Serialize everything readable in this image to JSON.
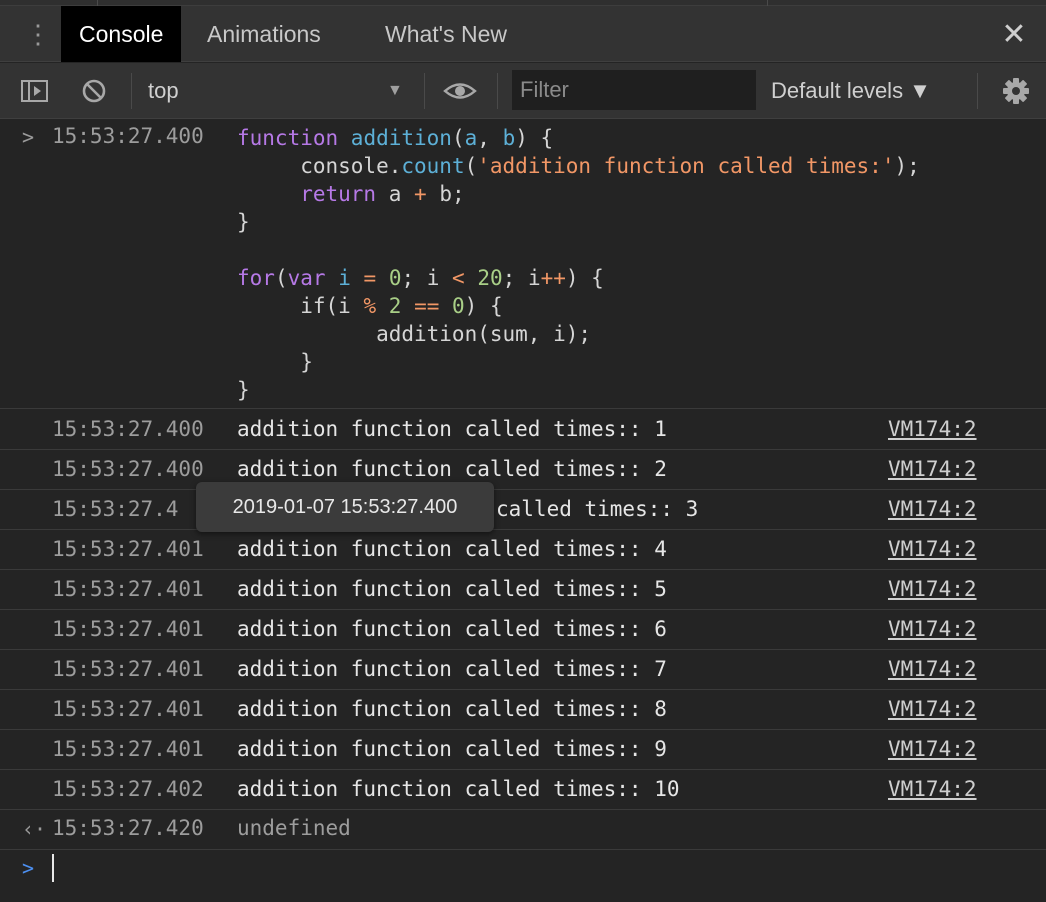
{
  "tabs": {
    "kebab": "⋮",
    "items": [
      {
        "label": "Console"
      },
      {
        "label": "Animations"
      },
      {
        "label": "What's New"
      }
    ],
    "close": "✕"
  },
  "toolbar": {
    "context": "top",
    "context_arrow": "▼",
    "filter_placeholder": "Filter",
    "levels": "Default levels ▼"
  },
  "input_entry": {
    "prompt": ">",
    "timestamp": "15:53:27.400"
  },
  "logs": [
    {
      "timestamp": "15:53:27.400",
      "message": "addition function called times:: 1",
      "source": "VM174:2"
    },
    {
      "timestamp": "15:53:27.400",
      "message": "addition function called times:: 2",
      "source": "VM174:2"
    },
    {
      "timestamp": "15:53:27.4",
      "message": "called times:: 3",
      "source": "VM174:2"
    },
    {
      "timestamp": "15:53:27.401",
      "message": "addition function called times:: 4",
      "source": "VM174:2"
    },
    {
      "timestamp": "15:53:27.401",
      "message": "addition function called times:: 5",
      "source": "VM174:2"
    },
    {
      "timestamp": "15:53:27.401",
      "message": "addition function called times:: 6",
      "source": "VM174:2"
    },
    {
      "timestamp": "15:53:27.401",
      "message": "addition function called times:: 7",
      "source": "VM174:2"
    },
    {
      "timestamp": "15:53:27.401",
      "message": "addition function called times:: 8",
      "source": "VM174:2"
    },
    {
      "timestamp": "15:53:27.401",
      "message": "addition function called times:: 9",
      "source": "VM174:2"
    },
    {
      "timestamp": "15:53:27.402",
      "message": "addition function called times:: 10",
      "source": "VM174:2"
    }
  ],
  "tooltip": "2019-01-07 15:53:27.400",
  "result": {
    "prompt": "‹·",
    "timestamp": "15:53:27.420",
    "value": "undefined"
  },
  "prompt": ">",
  "colors": {
    "keyword": "#b679e6",
    "function": "#5db0d7",
    "string": "#f29766",
    "number": "#a9cf87"
  },
  "code": [
    [
      {
        "t": "function ",
        "c": "kw"
      },
      {
        "t": "addition",
        "c": "fn"
      },
      {
        "t": "(",
        "c": "punct"
      },
      {
        "t": "a",
        "c": "var"
      },
      {
        "t": ", ",
        "c": "punct"
      },
      {
        "t": "b",
        "c": "var"
      },
      {
        "t": ") {",
        "c": "punct"
      }
    ],
    [
      {
        "t": "     console.",
        "c": "punct"
      },
      {
        "t": "count",
        "c": "fn"
      },
      {
        "t": "(",
        "c": "punct"
      },
      {
        "t": "'addition function called times:'",
        "c": "str"
      },
      {
        "t": ");",
        "c": "punct"
      }
    ],
    [
      {
        "t": "     ",
        "c": "punct"
      },
      {
        "t": "return",
        "c": "kw"
      },
      {
        "t": " a ",
        "c": "punct"
      },
      {
        "t": "+",
        "c": "op"
      },
      {
        "t": " b;",
        "c": "punct"
      }
    ],
    [
      {
        "t": "}",
        "c": "punct"
      }
    ],
    [
      {
        "t": "",
        "c": "punct"
      }
    ],
    [
      {
        "t": "for",
        "c": "kw"
      },
      {
        "t": "(",
        "c": "punct"
      },
      {
        "t": "var",
        "c": "kw"
      },
      {
        "t": " ",
        "c": "punct"
      },
      {
        "t": "i",
        "c": "var"
      },
      {
        "t": " ",
        "c": "punct"
      },
      {
        "t": "=",
        "c": "op"
      },
      {
        "t": " ",
        "c": "punct"
      },
      {
        "t": "0",
        "c": "num"
      },
      {
        "t": "; i ",
        "c": "punct"
      },
      {
        "t": "<",
        "c": "op"
      },
      {
        "t": " ",
        "c": "punct"
      },
      {
        "t": "20",
        "c": "num"
      },
      {
        "t": "; i",
        "c": "punct"
      },
      {
        "t": "++",
        "c": "op"
      },
      {
        "t": ") {",
        "c": "punct"
      }
    ],
    [
      {
        "t": "     if(i ",
        "c": "punct"
      },
      {
        "t": "%",
        "c": "op"
      },
      {
        "t": " ",
        "c": "punct"
      },
      {
        "t": "2",
        "c": "num"
      },
      {
        "t": " ",
        "c": "punct"
      },
      {
        "t": "==",
        "c": "op"
      },
      {
        "t": " ",
        "c": "punct"
      },
      {
        "t": "0",
        "c": "num"
      },
      {
        "t": ") {",
        "c": "punct"
      }
    ],
    [
      {
        "t": "           addition(sum, i);",
        "c": "punct"
      }
    ],
    [
      {
        "t": "     }",
        "c": "punct"
      }
    ],
    [
      {
        "t": "}",
        "c": "punct"
      }
    ]
  ]
}
